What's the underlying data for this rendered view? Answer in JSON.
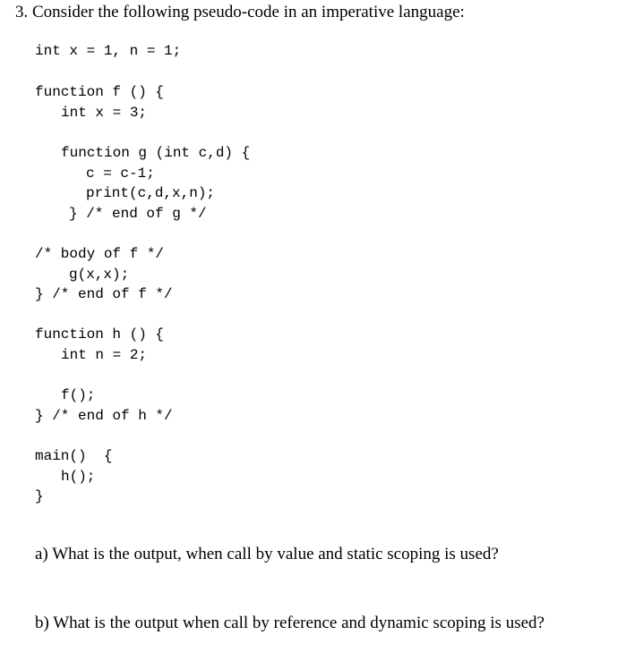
{
  "problem": {
    "number": "3.",
    "heading": "Consider the following pseudo-code in an imperative language:"
  },
  "code": {
    "lines": [
      "int x = 1, n = 1;",
      "function f () {",
      "int x = 3;",
      "function g (int c,d) {",
      "c = c-1;",
      "print(c,d,x,n);",
      "} /* end of g */",
      "/* body of f */",
      "g(x,x);",
      "} /* end of f */",
      "function h () {",
      "int n = 2;",
      "f();",
      "} /* end of h */",
      "main()  {",
      "h();",
      "}"
    ]
  },
  "questions": [
    {
      "label": "a)",
      "text": "What is the output, when call by value and static scoping is used?"
    },
    {
      "label": "b)",
      "text": "What is the output when call by reference and dynamic scoping is used?"
    }
  ]
}
